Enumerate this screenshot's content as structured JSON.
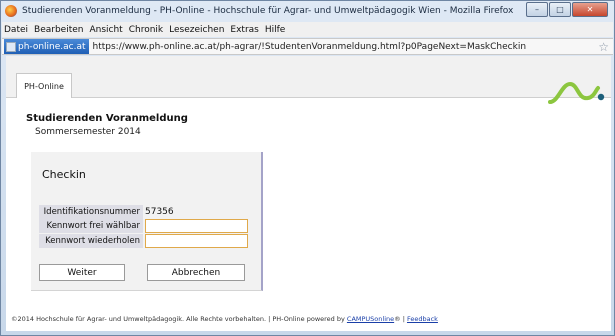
{
  "window": {
    "title": "Studierenden Voranmeldung - PH-Online - Hochschule für Agrar- und Umweltpädagogik Wien - Mozilla Firefox",
    "controls": {
      "minimize": "–",
      "maximize": "□",
      "close": "✕"
    }
  },
  "menubar": {
    "items": [
      "Datei",
      "Bearbeiten",
      "Ansicht",
      "Chronik",
      "Lesezeichen",
      "Extras",
      "Hilfe"
    ]
  },
  "urlbar": {
    "site_identity": "ph-online.ac.at",
    "url": "https://www.ph-online.ac.at/ph-agrar/!StudentenVoranmeldung.html?p0PageNext=MaskCheckin",
    "bookmark_star": "☆"
  },
  "page": {
    "tab_label": "PH-Online",
    "logo_colors": {
      "curve": "#8cc63f",
      "dot": "#1d5f7a"
    },
    "title": "Studierenden Voranmeldung",
    "subtitle": "Sommersemester 2014",
    "checkin": {
      "title": "Checkin",
      "id_label": "Identifikationsnummer",
      "id_value": "57356",
      "password_label": "Kennwort frei wählbar",
      "password_value": "",
      "repeat_label": "Kennwort wiederholen",
      "repeat_value": "",
      "next_button": "Weiter",
      "cancel_button": "Abbrechen"
    },
    "footer": {
      "text": "©2014 Hochschule für Agrar- und Umweltpädagogik. Alle Rechte vorbehalten. | PH-Online powered by ",
      "campus_link": "CAMPUSonline",
      "registered": "® | ",
      "feedback_link": "Feedback"
    }
  }
}
